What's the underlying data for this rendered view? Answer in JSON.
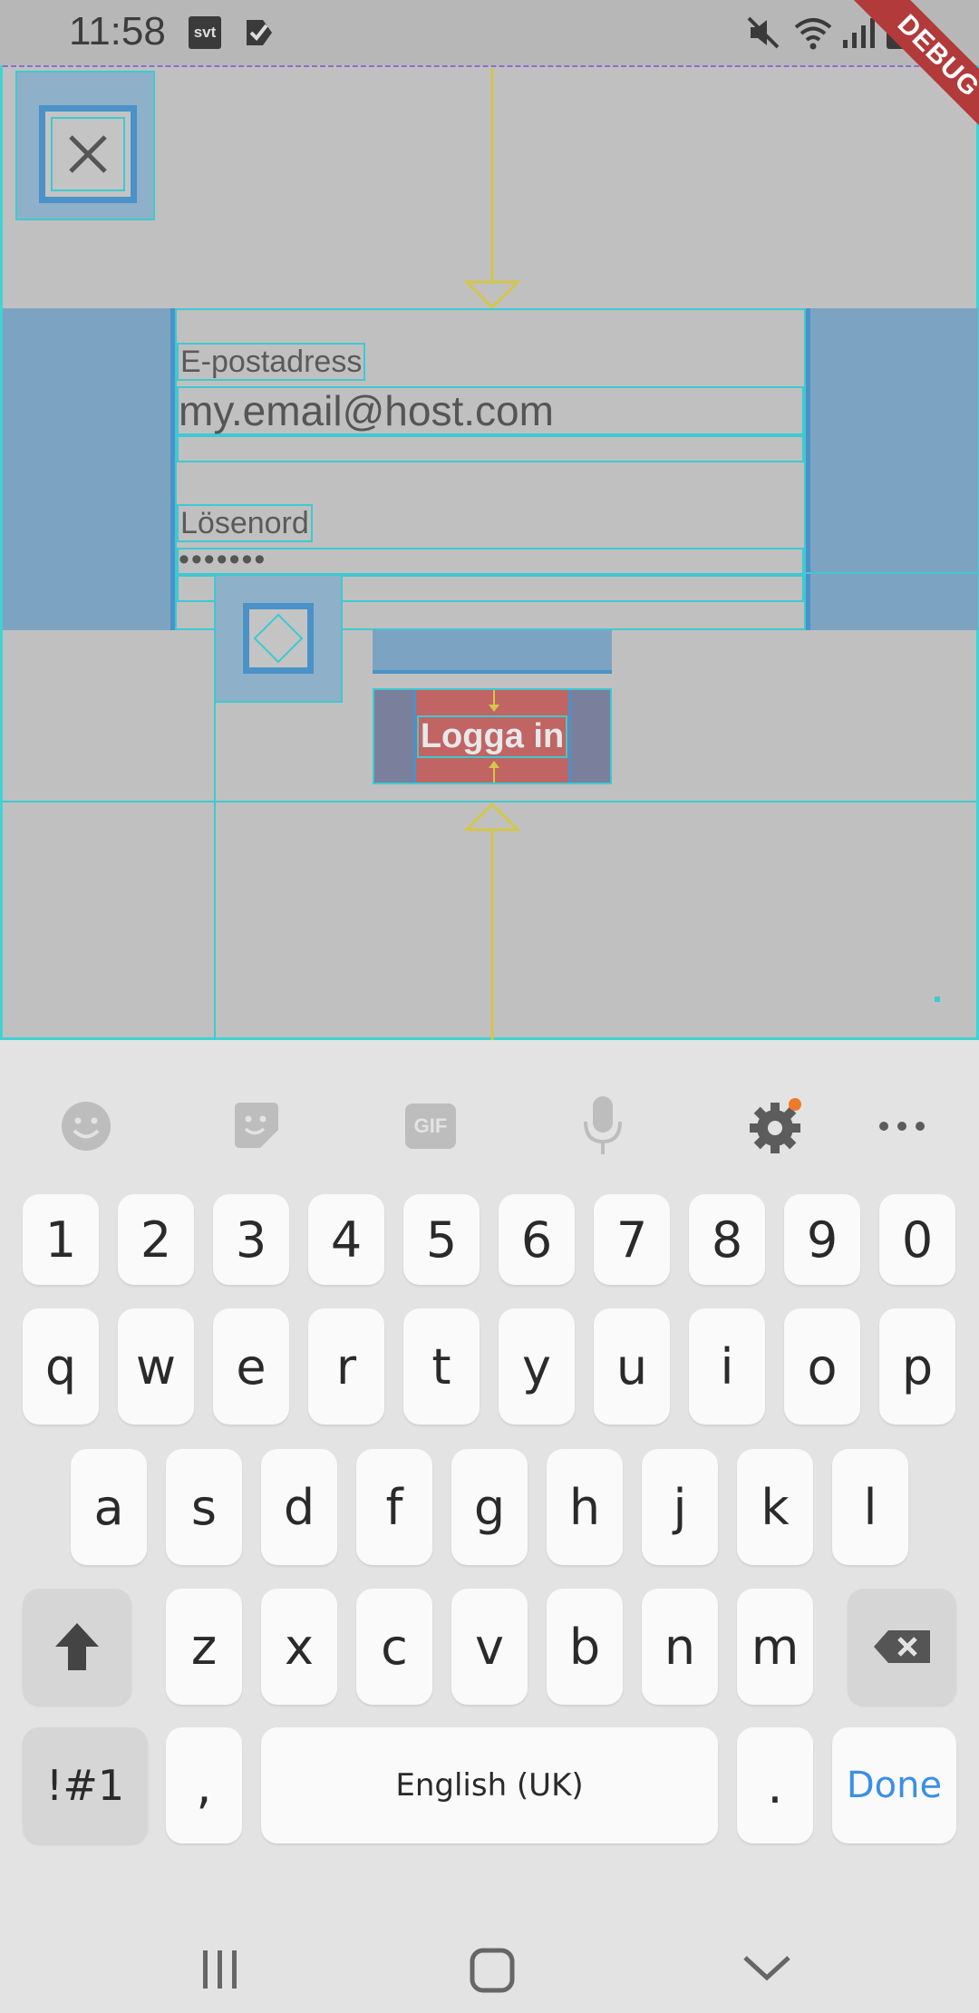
{
  "status_bar": {
    "time": "11:58",
    "icons": [
      "svt-icon",
      "check-icon",
      "mute-icon",
      "wifi-icon",
      "signal-icon",
      "battery-icon"
    ],
    "svt_label": "svt"
  },
  "debug_banner": "DEBUG",
  "form": {
    "email_label": "E-postadress",
    "email_value": "my.email@host.com",
    "password_label": "Lösenord",
    "password_value": "•••••••",
    "login_button": "Logga in"
  },
  "keyboard": {
    "toolbar_icons": [
      "emoji-icon",
      "sticker-icon",
      "gif-icon",
      "mic-icon",
      "settings-icon",
      "more-icon"
    ],
    "gif_label": "GIF",
    "row_numbers": [
      "1",
      "2",
      "3",
      "4",
      "5",
      "6",
      "7",
      "8",
      "9",
      "0"
    ],
    "row_top": [
      "q",
      "w",
      "e",
      "r",
      "t",
      "y",
      "u",
      "i",
      "o",
      "p"
    ],
    "row_middle": [
      "a",
      "s",
      "d",
      "f",
      "g",
      "h",
      "j",
      "k",
      "l"
    ],
    "row_bottom": [
      "z",
      "x",
      "c",
      "v",
      "b",
      "n",
      "m"
    ],
    "symbols_key": "!#1",
    "comma_key": ",",
    "space_key": "English (UK)",
    "period_key": ".",
    "done_key": "Done"
  },
  "colors": {
    "guide": "#3fc9d0",
    "arrow": "#d4c64a",
    "button": "#c06464",
    "done": "#3a8fe6",
    "settings_dot": "#f07a2a"
  }
}
